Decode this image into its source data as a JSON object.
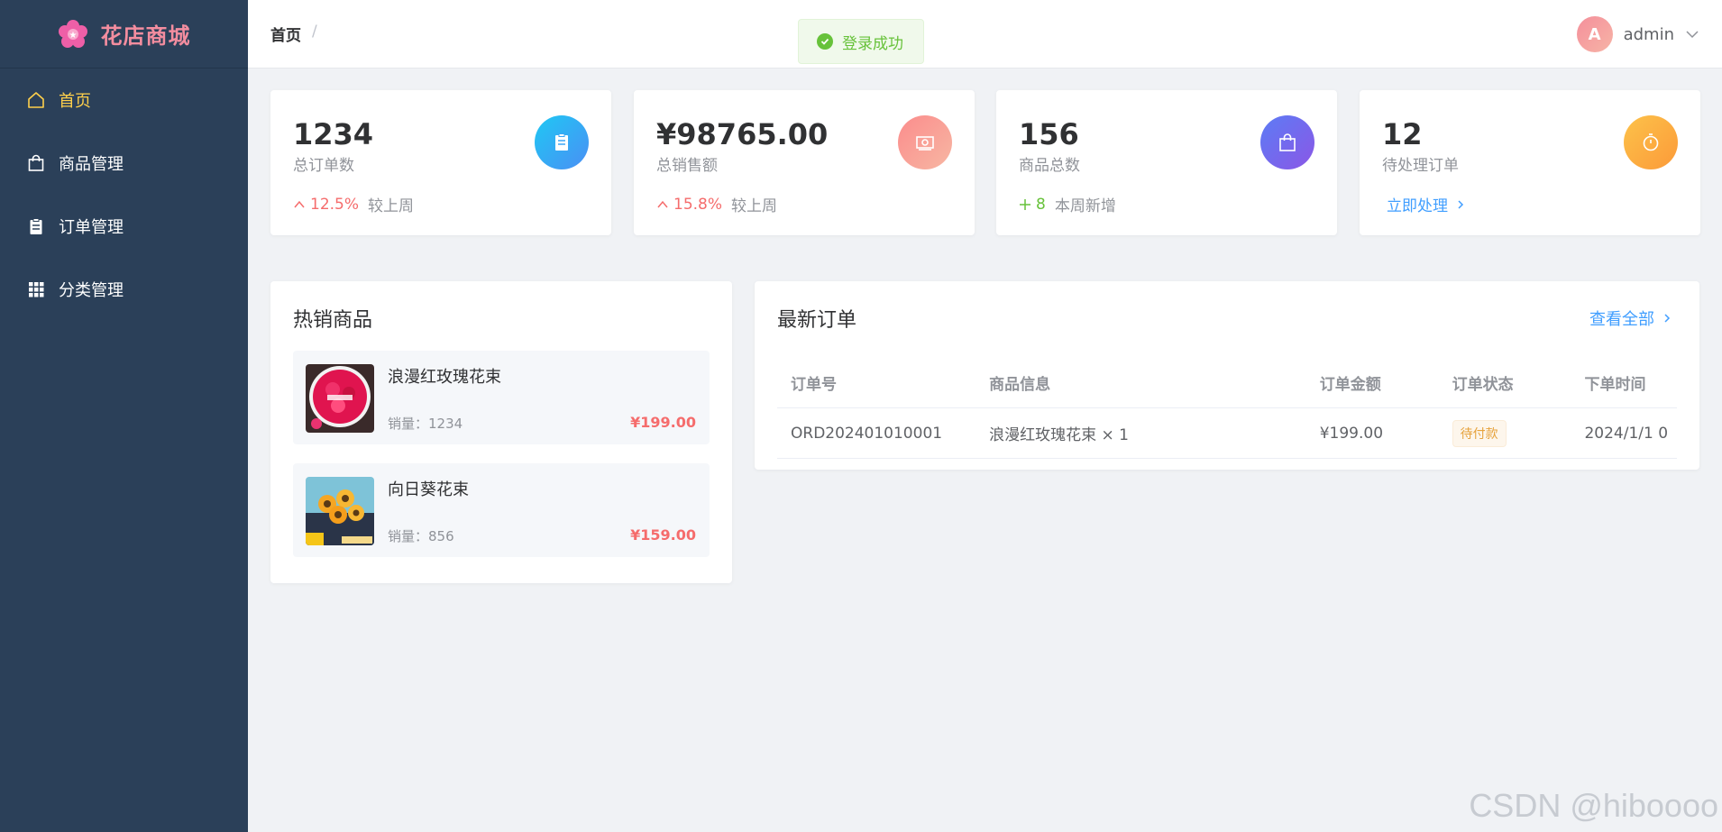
{
  "sidebar": {
    "logo_text": "花店商城",
    "items": [
      {
        "label": "首页",
        "icon": "home-icon",
        "active": true
      },
      {
        "label": "商品管理",
        "icon": "shopping-bag-icon",
        "active": false
      },
      {
        "label": "订单管理",
        "icon": "clipboard-icon",
        "active": false
      },
      {
        "label": "分类管理",
        "icon": "grid-icon",
        "active": false
      }
    ]
  },
  "header": {
    "breadcrumb": "首页",
    "breadcrumb_sep": "/",
    "avatar_letter": "A",
    "username": "admin"
  },
  "toast": {
    "message": "登录成功"
  },
  "stats": [
    {
      "value": "1234",
      "label": "总订单数",
      "trend": "12.5%",
      "trend_label": "较上周",
      "icon": "clipboard-icon",
      "color": "#3aa6f5"
    },
    {
      "value": "¥98765.00",
      "label": "总销售额",
      "trend": "15.8%",
      "trend_label": "较上周",
      "icon": "money-icon",
      "color": "#f7a1a1"
    },
    {
      "value": "156",
      "label": "商品总数",
      "trend": "8",
      "trend_label": "本周新增",
      "icon": "shopping-bag-icon",
      "color": "#6a66e8"
    },
    {
      "value": "12",
      "label": "待处理订单",
      "action": "立即处理",
      "icon": "stopwatch-icon",
      "color": "#fca63e"
    }
  ],
  "hot": {
    "title": "热销商品",
    "items": [
      {
        "name": "浪漫红玫瑰花束",
        "sales": "销量：1234",
        "price": "¥199.00"
      },
      {
        "name": "向日葵花束",
        "sales": "销量：856",
        "price": "¥159.00"
      }
    ]
  },
  "orders": {
    "title": "最新订单",
    "view_all": "查看全部",
    "columns": [
      "订单号",
      "商品信息",
      "订单金额",
      "订单状态",
      "下单时间"
    ],
    "rows": [
      {
        "id": "ORD202401010001",
        "product": "浪漫红玫瑰花束 × 1",
        "amount": "¥199.00",
        "status": "待付款",
        "time": "2024/1/1 0"
      }
    ]
  },
  "watermark": "CSDN @hiboooo"
}
